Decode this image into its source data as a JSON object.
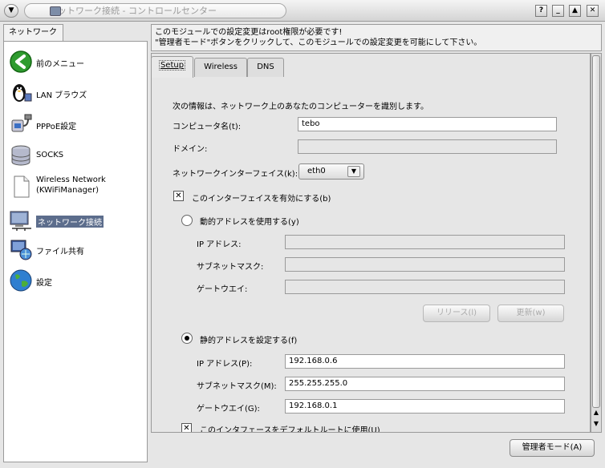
{
  "window": {
    "title": "ネットワーク接続 - コントロールセンター",
    "menu_glyph": "▼",
    "help_glyph": "?",
    "minimize_glyph": "_",
    "shade_glyph": "▲",
    "close_glyph": "✕"
  },
  "sidebar": {
    "tab_label": "ネットワーク",
    "items": [
      {
        "label": "前のメニュー"
      },
      {
        "label": "LAN ブラウズ"
      },
      {
        "label": "PPPoE設定"
      },
      {
        "label": "SOCKS"
      },
      {
        "label": "Wireless Network (KWiFiManager)"
      },
      {
        "label": "ネットワーク接続"
      },
      {
        "label": "ファイル共有"
      },
      {
        "label": "設定"
      }
    ]
  },
  "info": {
    "line1": "このモジュールでの設定変更はroot権限が必要です!",
    "line2": "\"管理者モード\"ボタンをクリックして、このモジュールでの設定変更を可能にして下さい。"
  },
  "tabs": {
    "setup": "Setup",
    "wireless": "Wireless",
    "dns": "DNS"
  },
  "setup": {
    "intro": "次の情報は、ネットワーク上のあなたのコンピューターを識別します。",
    "computer_name_label": "コンピュータ名(t):",
    "computer_name_value": "tebo",
    "domain_label": "ドメイン:",
    "domain_value": "",
    "interface_label": "ネットワークインターフェイス(k):",
    "interface_value": "eth0",
    "enable_interface_label": "このインターフェイスを有効にする(b)",
    "dynamic_label": "動的アドレスを使用する(y)",
    "dyn_ip_label": "IP アドレス:",
    "dyn_subnet_label": "サブネットマスク:",
    "dyn_gateway_label": "ゲートウエイ:",
    "release_button": "リリース(l)",
    "renew_button": "更新(w)",
    "static_label": "静的アドレスを設定する(f)",
    "ip_label": "IP アドレス(P):",
    "ip_value": "192.168.0.6",
    "subnet_label": "サブネットマスク(M):",
    "subnet_value": "255.255.255.0",
    "gateway_label": "ゲートウエイ(G):",
    "gateway_value": "192.168.0.1",
    "default_route_label": "このインタフェースをデフォルトルートに使用(U)"
  },
  "footer": {
    "admin_button": "管理者モード(A)"
  }
}
